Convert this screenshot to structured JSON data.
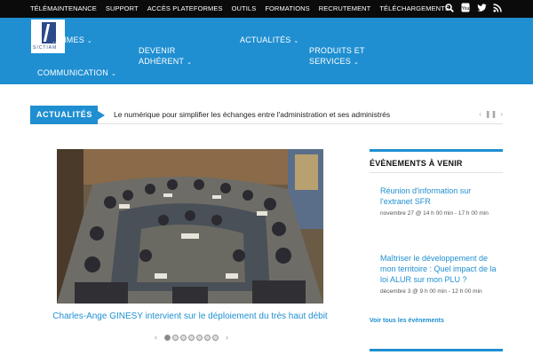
{
  "topbar": {
    "links": [
      "TÉLÉMAINTENANCE",
      "SUPPORT",
      "ACCÈS PLATEFORMES",
      "OUTILS",
      "FORMATIONS",
      "RECRUTEMENT",
      "TÉLÉCHARGEMENTS"
    ],
    "social_icons": [
      "search-icon",
      "youtube-icon",
      "twitter-icon",
      "rss-icon"
    ]
  },
  "logo": {
    "text": "SICTIAM"
  },
  "nav": {
    "items": [
      {
        "label": "...MMES"
      },
      {
        "label": "DEVENIR\nADHÉRENT"
      },
      {
        "label": "ACTUALITÉS"
      },
      {
        "label": "PRODUITS ET\nSERVICES"
      },
      {
        "label": "COMMUNICATION"
      }
    ]
  },
  "ticker": {
    "label": "ACTUALITÉS",
    "message": "Le numérique pour simplifier les échanges entre l'administration et ses administrés"
  },
  "slider": {
    "caption": "Charles-Ange GINESY intervient sur le déploiement du très haut débit",
    "current": 1,
    "total": 7
  },
  "events": {
    "title": "ÉVÈNEMENTS À VENIR",
    "items": [
      {
        "title": "Réunion d'information sur l'extranet SFR",
        "date": "novembre 27 @ 14 h 00 min - 17 h 00 min"
      },
      {
        "title": "Maîtriser le développement de mon territoire : Quel impact de la loi ALUR sur mon PLU ?",
        "date": "décembre 3 @ 9 h 00 min - 12 h 00 min"
      }
    ],
    "all_link": "Voir tous les évènements"
  },
  "colors": {
    "accent": "#1f8fd1",
    "topbar": "#0b0b0b"
  }
}
